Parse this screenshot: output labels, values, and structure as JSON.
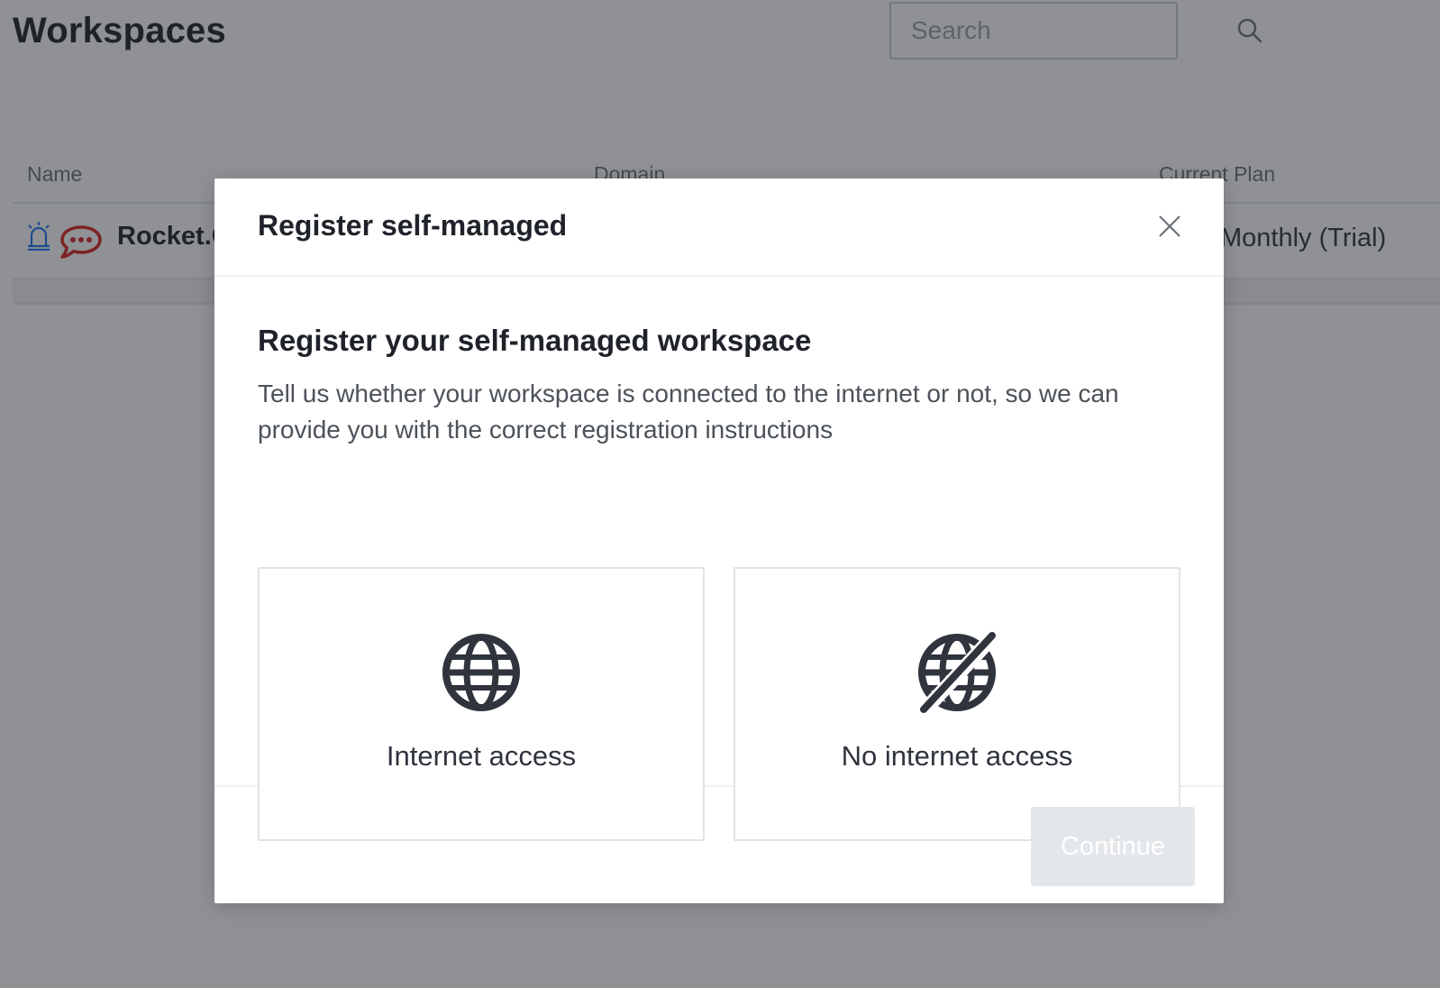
{
  "page": {
    "title": "Workspaces",
    "search": {
      "placeholder": "Search",
      "value": ""
    }
  },
  "table": {
    "columns": [
      "Name",
      "Domain",
      "Current Plan"
    ],
    "rows": [
      {
        "name": "Rocket.C",
        "plan": "Monthly (Trial)"
      }
    ]
  },
  "modal": {
    "title": "Register self-managed",
    "heading": "Register your self-managed workspace",
    "description": "Tell us whether your workspace is connected to the internet or not, so we can provide you with the correct registration instructions",
    "options": [
      {
        "label": "Internet access",
        "icon": "globe-icon"
      },
      {
        "label": "No internet access",
        "icon": "globe-off-icon"
      }
    ],
    "continue_label": "Continue"
  },
  "colors": {
    "logo_red": "#db2323",
    "bell_blue": "#1d74f5",
    "overlay": "rgba(31,35,41,0.5)",
    "disabled_button": "#e4e7ea"
  }
}
